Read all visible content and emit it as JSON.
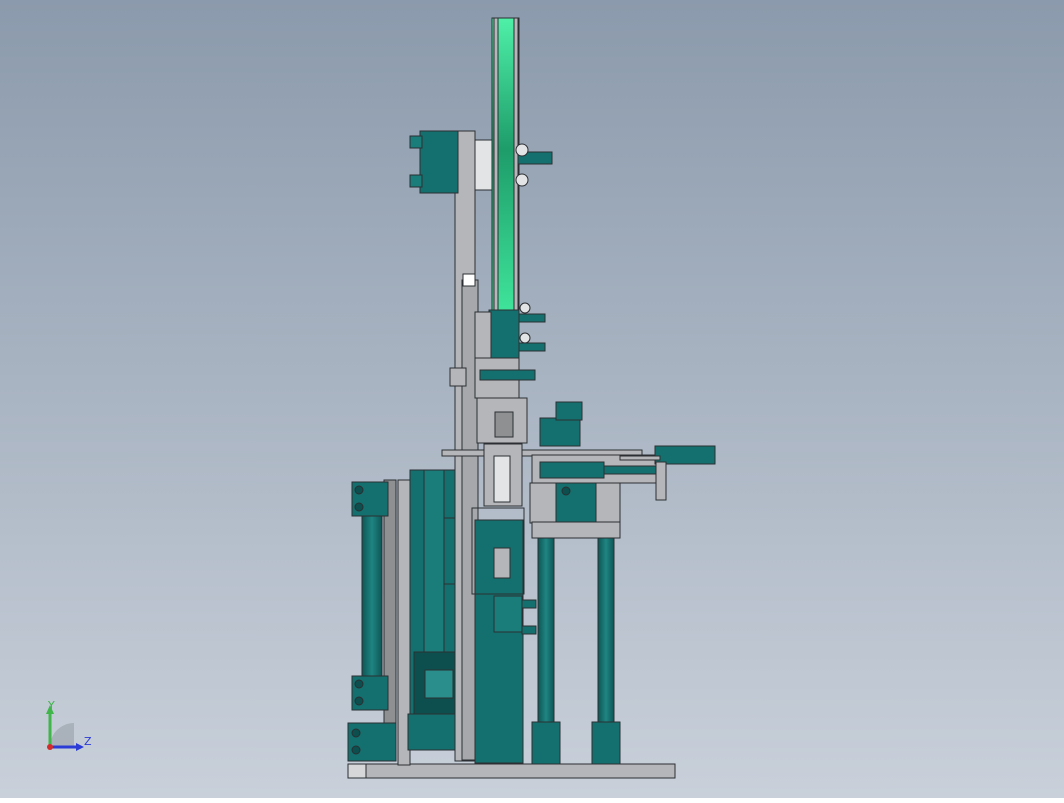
{
  "viewport": {
    "background_top": "#8b9aac",
    "background_bottom": "#c9d0da"
  },
  "colors": {
    "teal": "#14706e",
    "teal_dark": "#0c4f4e",
    "teal_light": "#2a8f8c",
    "steel": "#b4b6b9",
    "steel_dark": "#8e9092",
    "green_disc": "#2fcf8a",
    "outline": "#2b2f33"
  },
  "triad": {
    "y_label": "Y",
    "z_label": "Z",
    "y_color": "#3fb54a",
    "z_color": "#2a3bd6",
    "x_color": "#d42a2a"
  }
}
